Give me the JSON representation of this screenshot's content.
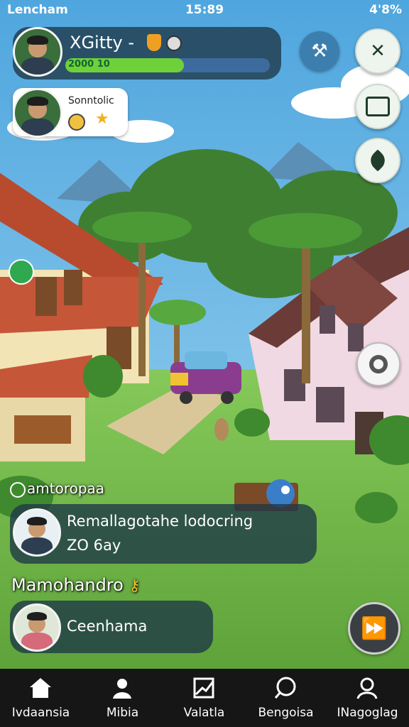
{
  "status_bar": {
    "carrier": "Lencham",
    "time": "15:89",
    "battery": "4'8%"
  },
  "player": {
    "name": "XGitty -",
    "xp_label": "2000 10",
    "xp_progress": 0.58
  },
  "friend_card": {
    "name": "Sonntolic"
  },
  "location_label": "amtoropaa",
  "activity_card": {
    "line1": "Remallagotahe lodocring",
    "line2": "ZO 6ay"
  },
  "section_label": "Mamohandro",
  "chat_card": {
    "text": "Ceenhama"
  },
  "nav": {
    "items": [
      {
        "label": "Ivdaansia",
        "icon": "home-icon"
      },
      {
        "label": "Mibia",
        "icon": "person-icon"
      },
      {
        "label": "Valatla",
        "icon": "chart-icon"
      },
      {
        "label": "Bengoisa",
        "icon": "chat-icon"
      },
      {
        "label": "INagoglag",
        "icon": "profile-icon"
      }
    ]
  },
  "colors": {
    "sky": "#7cc0e8",
    "grass": "#7fc24f",
    "xp_bar": "#6fd13a",
    "panel": "#1e3746",
    "nav_bg": "#161616"
  }
}
